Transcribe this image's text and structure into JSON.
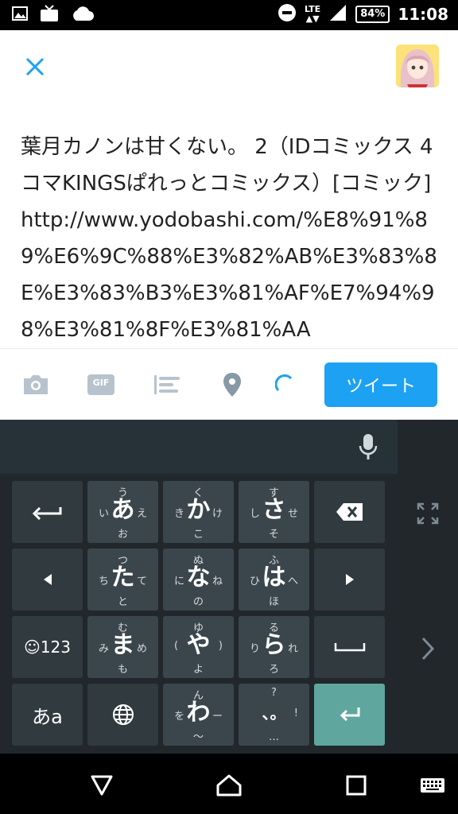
{
  "status_bar": {
    "network_label": "LTE",
    "battery": "84%",
    "time": "11:08",
    "left_icons": [
      "gallery-icon",
      "tv-icon",
      "cloud-icon"
    ],
    "right_icons": [
      "dnd-icon",
      "signal-icon"
    ]
  },
  "compose": {
    "tweet_text": "葉月カノンは甘くない。 2（IDコミックス 4コマKINGSぱれっとコミックス）[コミック] http://www.yodobashi.com/%E8%91%89%E6%9C%88%E3%82%AB%E3%83%8E%E3%83%B3%E3%81%AF%E7%94%98%E3%81%8F%E3%81%AA"
  },
  "toolbar": {
    "tweet_button_label": "ツイート",
    "gif_label": "GIF",
    "accent_color": "#1da1f2"
  },
  "keyboard": {
    "enter_color": "#5fa79e",
    "emoji_num_label": "☺123",
    "kana_mode_label": "あa",
    "rows": [
      [
        {
          "center": "あ",
          "top": "う",
          "left": "い",
          "right": "え",
          "bottom": "お"
        },
        {
          "center": "か",
          "top": "く",
          "left": "き",
          "right": "け",
          "bottom": "こ"
        },
        {
          "center": "さ",
          "top": "す",
          "left": "し",
          "right": "せ",
          "bottom": "そ"
        }
      ],
      [
        {
          "center": "た",
          "top": "つ",
          "left": "ち",
          "right": "て",
          "bottom": "と"
        },
        {
          "center": "な",
          "top": "ぬ",
          "left": "に",
          "right": "ね",
          "bottom": "の"
        },
        {
          "center": "は",
          "top": "ふ",
          "left": "ひ",
          "right": "へ",
          "bottom": "ほ"
        }
      ],
      [
        {
          "center": "ま",
          "top": "む",
          "left": "み",
          "right": "め",
          "bottom": "も"
        },
        {
          "center": "や",
          "top": "ゆ",
          "left": "(",
          "right": ")",
          "bottom": "よ"
        },
        {
          "center": "ら",
          "top": "る",
          "left": "り",
          "right": "れ",
          "bottom": "ろ"
        }
      ],
      [
        {
          "center": "わ",
          "top": "ん",
          "left": "を",
          "right": "ー",
          "bottom": "〜"
        },
        {
          "center": "、。",
          "top": "?",
          "left": "",
          "right": "!",
          "bottom": "…"
        }
      ]
    ]
  },
  "nav_bar": {
    "icons": [
      "back-icon",
      "home-icon",
      "recents-icon",
      "keyboard-switch-icon"
    ]
  }
}
